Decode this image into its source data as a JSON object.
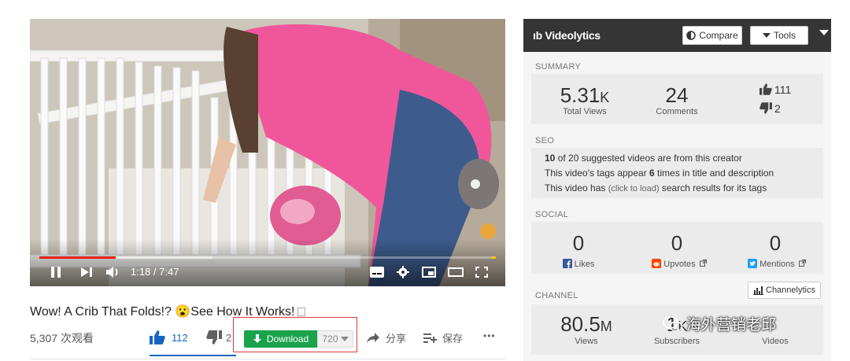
{
  "player": {
    "time": "1:18 / 7:47",
    "progress_played": 0.167,
    "progress_loaded": 0.38
  },
  "video": {
    "title": "Wow! A Crib That Folds!? 😮See How It Works!",
    "views": "5,307 次观看",
    "likes": "112",
    "dislikes": "2",
    "download_label": "Download",
    "quality": "720",
    "share_label": "分享",
    "save_label": "保存",
    "more_label": "•••"
  },
  "panel": {
    "brand": "ıb Videolytics",
    "compare_label": "Compare",
    "tools_label": "Tools",
    "summary": {
      "heading": "SUMMARY",
      "total_views": "5.31",
      "total_views_unit": "K",
      "total_views_label": "Total Views",
      "comments": "24",
      "comments_label": "Comments",
      "likes": "111",
      "dislikes": "2"
    },
    "seo": {
      "heading": "SEO",
      "line1_num": "10",
      "line1_text": " of 20 suggested videos are from this creator",
      "line2_pre": "This video's tags appear ",
      "line2_num": "6",
      "line2_post": " times in title and description",
      "line3_pre": "This video has ",
      "line3_link": "(click to load)",
      "line3_post": " search results for its tags"
    },
    "social": {
      "heading": "SOCIAL",
      "likes_value": "0",
      "likes_label": "Likes",
      "upvotes_value": "0",
      "upvotes_label": "Upvotes",
      "mentions_value": "0",
      "mentions_label": "Mentions"
    },
    "channel": {
      "heading": "CHANNEL",
      "channelytics_label": "Channelytics",
      "views_value": "80.5",
      "views_unit": "M",
      "views_label": "Views",
      "subscribers_value": "1",
      "subscribers_unit": "K",
      "subscribers_label": "Subscribers",
      "videos_label": "Videos"
    }
  },
  "watermark": "海外营销老邱",
  "colors": {
    "accent_red": "#e62117",
    "download_green": "#1aa34a",
    "like_blue": "#1565c0",
    "panel_header": "#353535",
    "highlight_box": "#e53935"
  }
}
